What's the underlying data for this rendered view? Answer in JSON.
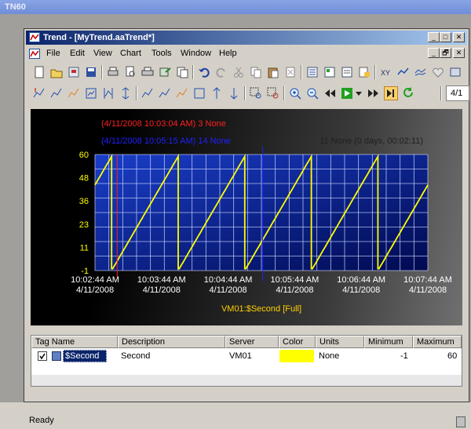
{
  "outer_window": {
    "title": "TN60"
  },
  "window": {
    "title": "Trend - [MyTrend.aaTrend*]",
    "controls": {
      "minimize": "_",
      "maximize": "□",
      "close": "✕",
      "restore": "🗗"
    }
  },
  "menu": {
    "items": [
      "File",
      "Edit",
      "View",
      "Chart",
      "Tools",
      "Window",
      "Help"
    ]
  },
  "toolbar": {
    "date_field": "4/1"
  },
  "chart_data": {
    "type": "line",
    "series": [
      {
        "name": "VM01:$Second [Full]",
        "color": "#ffff00"
      }
    ],
    "cursors": [
      {
        "label": "(4/11/2008 10:03:04 AM) 3 None",
        "color": "#ff2020"
      },
      {
        "label": "(4/11/2008 10:05:15 AM) 14 None",
        "color": "#2020ff"
      }
    ],
    "delta_label": "11 None (0 days, 00:02:11)",
    "y_ticks": [
      "60",
      "48",
      "36",
      "23",
      "11",
      "-1"
    ],
    "x_ticks": [
      {
        "time": "10:02:44 AM",
        "date": "4/11/2008"
      },
      {
        "time": "10:03:44 AM",
        "date": "4/11/2008"
      },
      {
        "time": "10:04:44 AM",
        "date": "4/11/2008"
      },
      {
        "time": "10:05:44 AM",
        "date": "4/11/2008"
      },
      {
        "time": "10:06:44 AM",
        "date": "4/11/2008"
      },
      {
        "time": "10:07:44 AM",
        "date": "4/11/2008"
      }
    ],
    "ylim": [
      -1,
      60
    ],
    "series_label": "VM01:$Second [Full]",
    "grid": true
  },
  "legend": {
    "headers": [
      "Tag Name",
      "Description",
      "Server",
      "Color",
      "Units",
      "Minimum",
      "Maximum"
    ],
    "rows": [
      {
        "tag": "$Second",
        "description": "Second",
        "server": "VM01",
        "color": "#ffff00",
        "units": "None",
        "minimum": "-1",
        "maximum": "60",
        "checked": true
      }
    ]
  },
  "status": {
    "text": "Ready"
  }
}
